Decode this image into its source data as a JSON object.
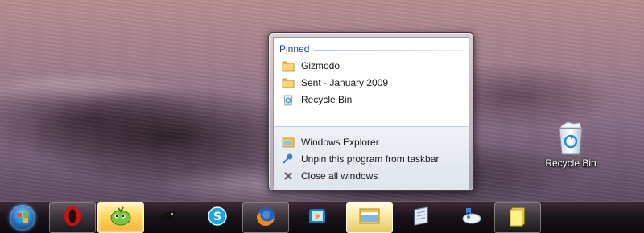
{
  "desktop": {
    "icons": [
      {
        "label": "Recycle Bin",
        "icon": "recycle-bin-full-icon"
      }
    ]
  },
  "jumplist": {
    "pinned_header": "Pinned",
    "pinned": [
      {
        "label": "Gizmodo",
        "icon": "folder-icon"
      },
      {
        "label": "Sent - January 2009",
        "icon": "folder-icon"
      },
      {
        "label": "Recycle Bin",
        "icon": "recycle-bin-icon"
      }
    ],
    "tasks": [
      {
        "label": "Windows Explorer",
        "icon": "explorer-icon"
      },
      {
        "label": "Unpin this program from taskbar",
        "icon": "unpin-icon"
      },
      {
        "label": "Close all windows",
        "icon": "close-x-icon"
      }
    ]
  },
  "taskbar": {
    "start": {
      "icon": "windows-logo-icon"
    },
    "buttons": [
      {
        "app": "opera",
        "icon": "opera-icon",
        "state": "open"
      },
      {
        "app": "digsby",
        "icon": "digsby-icon",
        "state": "active"
      },
      {
        "app": "twitter-client",
        "icon": "crow-icon",
        "state": "normal"
      },
      {
        "app": "skype",
        "icon": "skype-icon",
        "state": "normal"
      },
      {
        "app": "firefox",
        "icon": "firefox-icon",
        "state": "open"
      },
      {
        "app": "media-center",
        "icon": "media-player-icon",
        "state": "normal"
      },
      {
        "app": "windows-explorer",
        "icon": "explorer-icon",
        "state": "pressed"
      },
      {
        "app": "windows-journal",
        "icon": "journal-icon",
        "state": "normal"
      },
      {
        "app": "messenger",
        "icon": "chat-icon",
        "state": "normal"
      },
      {
        "app": "sticky-notes",
        "icon": "sticky-notes-icon",
        "state": "open"
      }
    ]
  }
}
